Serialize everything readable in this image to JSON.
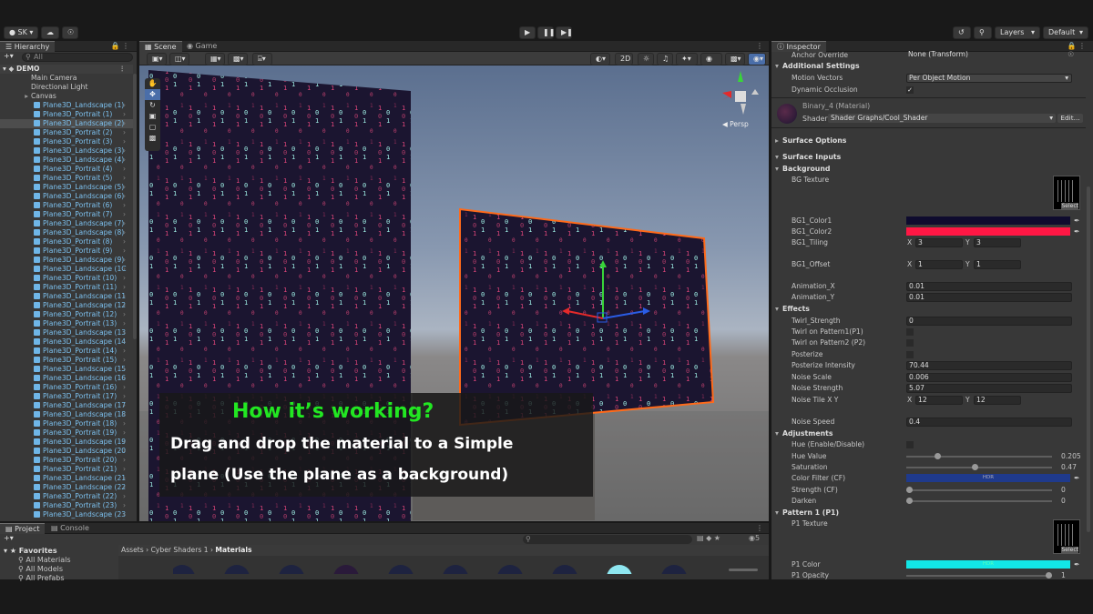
{
  "toolbar": {
    "account": "SK",
    "layers": "Layers",
    "layout": "Default"
  },
  "hierarchy": {
    "tab": "Hierarchy",
    "search_placeholder": "All",
    "scene": "DEMO",
    "items": [
      {
        "label": "Main Camera",
        "kind": "plain",
        "indent": 1
      },
      {
        "label": "Directional Light",
        "kind": "plain",
        "indent": 1
      },
      {
        "label": "Canvas",
        "kind": "arrow",
        "indent": 1
      },
      {
        "label": "Plane3D_Landscape (1)",
        "kind": "cube"
      },
      {
        "label": "Plane3D_Portrait (1)",
        "kind": "cube"
      },
      {
        "label": "Plane3D_Landscape (2)",
        "kind": "cube",
        "selected": true
      },
      {
        "label": "Plane3D_Portrait (2)",
        "kind": "cube"
      },
      {
        "label": "Plane3D_Portrait (3)",
        "kind": "cube"
      },
      {
        "label": "Plane3D_Landscape (3)",
        "kind": "cube"
      },
      {
        "label": "Plane3D_Landscape (4)",
        "kind": "cube"
      },
      {
        "label": "Plane3D_Portrait (4)",
        "kind": "cube"
      },
      {
        "label": "Plane3D_Portrait (5)",
        "kind": "cube"
      },
      {
        "label": "Plane3D_Landscape (5)",
        "kind": "cube"
      },
      {
        "label": "Plane3D_Landscape (6)",
        "kind": "cube"
      },
      {
        "label": "Plane3D_Portrait (6)",
        "kind": "cube"
      },
      {
        "label": "Plane3D_Portrait (7)",
        "kind": "cube"
      },
      {
        "label": "Plane3D_Landscape (7)",
        "kind": "cube"
      },
      {
        "label": "Plane3D_Landscape (8)",
        "kind": "cube"
      },
      {
        "label": "Plane3D_Portrait (8)",
        "kind": "cube"
      },
      {
        "label": "Plane3D_Portrait (9)",
        "kind": "cube"
      },
      {
        "label": "Plane3D_Landscape (9)",
        "kind": "cube"
      },
      {
        "label": "Plane3D_Landscape (1C",
        "kind": "cube"
      },
      {
        "label": "Plane3D_Portrait (10)",
        "kind": "cube"
      },
      {
        "label": "Plane3D_Portrait (11)",
        "kind": "cube"
      },
      {
        "label": "Plane3D_Landscape (11",
        "kind": "cube"
      },
      {
        "label": "Plane3D_Landscape (12",
        "kind": "cube"
      },
      {
        "label": "Plane3D_Portrait (12)",
        "kind": "cube"
      },
      {
        "label": "Plane3D_Portrait (13)",
        "kind": "cube"
      },
      {
        "label": "Plane3D_Landscape (13",
        "kind": "cube"
      },
      {
        "label": "Plane3D_Landscape (14",
        "kind": "cube"
      },
      {
        "label": "Plane3D_Portrait (14)",
        "kind": "cube"
      },
      {
        "label": "Plane3D_Portrait (15)",
        "kind": "cube"
      },
      {
        "label": "Plane3D_Landscape (15",
        "kind": "cube"
      },
      {
        "label": "Plane3D_Landscape (16",
        "kind": "cube"
      },
      {
        "label": "Plane3D_Portrait (16)",
        "kind": "cube"
      },
      {
        "label": "Plane3D_Portrait (17)",
        "kind": "cube"
      },
      {
        "label": "Plane3D_Landscape (17",
        "kind": "cube"
      },
      {
        "label": "Plane3D_Landscape (18",
        "kind": "cube"
      },
      {
        "label": "Plane3D_Portrait (18)",
        "kind": "cube"
      },
      {
        "label": "Plane3D_Portrait (19)",
        "kind": "cube"
      },
      {
        "label": "Plane3D_Landscape (19",
        "kind": "cube"
      },
      {
        "label": "Plane3D_Landscape (20",
        "kind": "cube"
      },
      {
        "label": "Plane3D_Portrait (20)",
        "kind": "cube"
      },
      {
        "label": "Plane3D_Portrait (21)",
        "kind": "cube"
      },
      {
        "label": "Plane3D_Landscape (21",
        "kind": "cube"
      },
      {
        "label": "Plane3D_Landscape (22",
        "kind": "cube"
      },
      {
        "label": "Plane3D_Portrait (22)",
        "kind": "cube"
      },
      {
        "label": "Plane3D_Portrait (23)",
        "kind": "cube"
      },
      {
        "label": "Plane3D_Landscape (23",
        "kind": "cube"
      }
    ]
  },
  "scene": {
    "tabs": [
      "Scene",
      "Game"
    ],
    "btn_2d": "2D",
    "persp": "Persp",
    "overlay_title": "How it’s working?",
    "overlay_line1": "Drag and drop the material to a Simple",
    "overlay_line2": "plane (Use the plane as a background)"
  },
  "project": {
    "tabs": [
      "Project",
      "Console"
    ],
    "favorites": "Favorites",
    "fav_items": [
      "All Materials",
      "All Models",
      "All Prefabs"
    ],
    "breadcrumb": [
      "Assets",
      "Cyber Shaders 1",
      "Materials"
    ],
    "hidden_count": "5"
  },
  "inspector": {
    "tab": "Inspector",
    "anchor_label": "Anchor Override",
    "anchor_value": "None (Transform)",
    "additional": "Additional Settings",
    "motion_label": "Motion Vectors",
    "motion_value": "Per Object Motion",
    "dyn_label": "Dynamic Occlusion",
    "material_name": "Binary_4 (Material)",
    "shader_label": "Shader",
    "shader_value": "Shader Graphs/Cool_Shader",
    "edit": "Edit...",
    "surface_options": "Surface Options",
    "surface_inputs": "Surface Inputs",
    "background": "Background",
    "bg_texture": "BG Texture",
    "select": "Select",
    "bg1_color1": "BG1_Color1",
    "bg1_color2": "BG1_Color2",
    "bg1_tiling": "BG1_Tiling",
    "tiling_x": "3",
    "tiling_y": "3",
    "bg1_offset": "BG1_Offset",
    "offset_x": "1",
    "offset_y": "1",
    "anim_x_label": "Animation_X",
    "anim_x": "0.01",
    "anim_y_label": "Animation_Y",
    "anim_y": "0.01",
    "effects": "Effects",
    "twirl_label": "Twirl_Strength",
    "twirl": "0",
    "twirl1": "Twirl on Pattern1(P1)",
    "twirl2": "Twirl on Pattern2 (P2)",
    "posterize": "Posterize",
    "posterize_int_label": "Posterize Intensity",
    "posterize_int": "70.44",
    "noise_scale_label": "Noise Scale",
    "noise_scale": "0.006",
    "noise_strength_label": "Noise Strength",
    "noise_strength": "5.07",
    "noise_tile_label": "Noise Tile X Y",
    "noise_tile_x": "12",
    "noise_tile_y": "12",
    "noise_speed_label": "Noise Speed",
    "noise_speed": "0.4",
    "adjustments": "Adjustments",
    "hue_enable": "Hue (Enable/Disable)",
    "hue_value_label": "Hue Value",
    "hue_value": "0.205",
    "hue_frac": 0.205,
    "saturation_label": "Saturation",
    "saturation": "0.47",
    "saturation_frac": 0.47,
    "color_filter": "Color Filter (CF)",
    "hdr": "HDR",
    "strength_label": "Strength (CF)",
    "strength": "0",
    "strength_frac": 0,
    "darken_label": "Darken",
    "darken": "0",
    "darken_frac": 0,
    "pattern1": "Pattern 1 (P1)",
    "p1_texture": "P1 Texture",
    "p1_color": "P1 Color",
    "p1_opacity": "P1 Opacity",
    "p1_opacity_val": "1",
    "p1_opacity_frac": 1,
    "x": "X",
    "y": "Y"
  },
  "colors": {
    "bg1_color1": "#0e0b2e",
    "bg1_color2": "#ff1744",
    "color_filter": "#1f3a8c",
    "p1_color": "#12e6e6",
    "matrix_pink": "#e0457a",
    "matrix_cyan": "#9ff0e6",
    "overlay_title": "#22e722",
    "selection_orange": "#ff6a1a"
  }
}
